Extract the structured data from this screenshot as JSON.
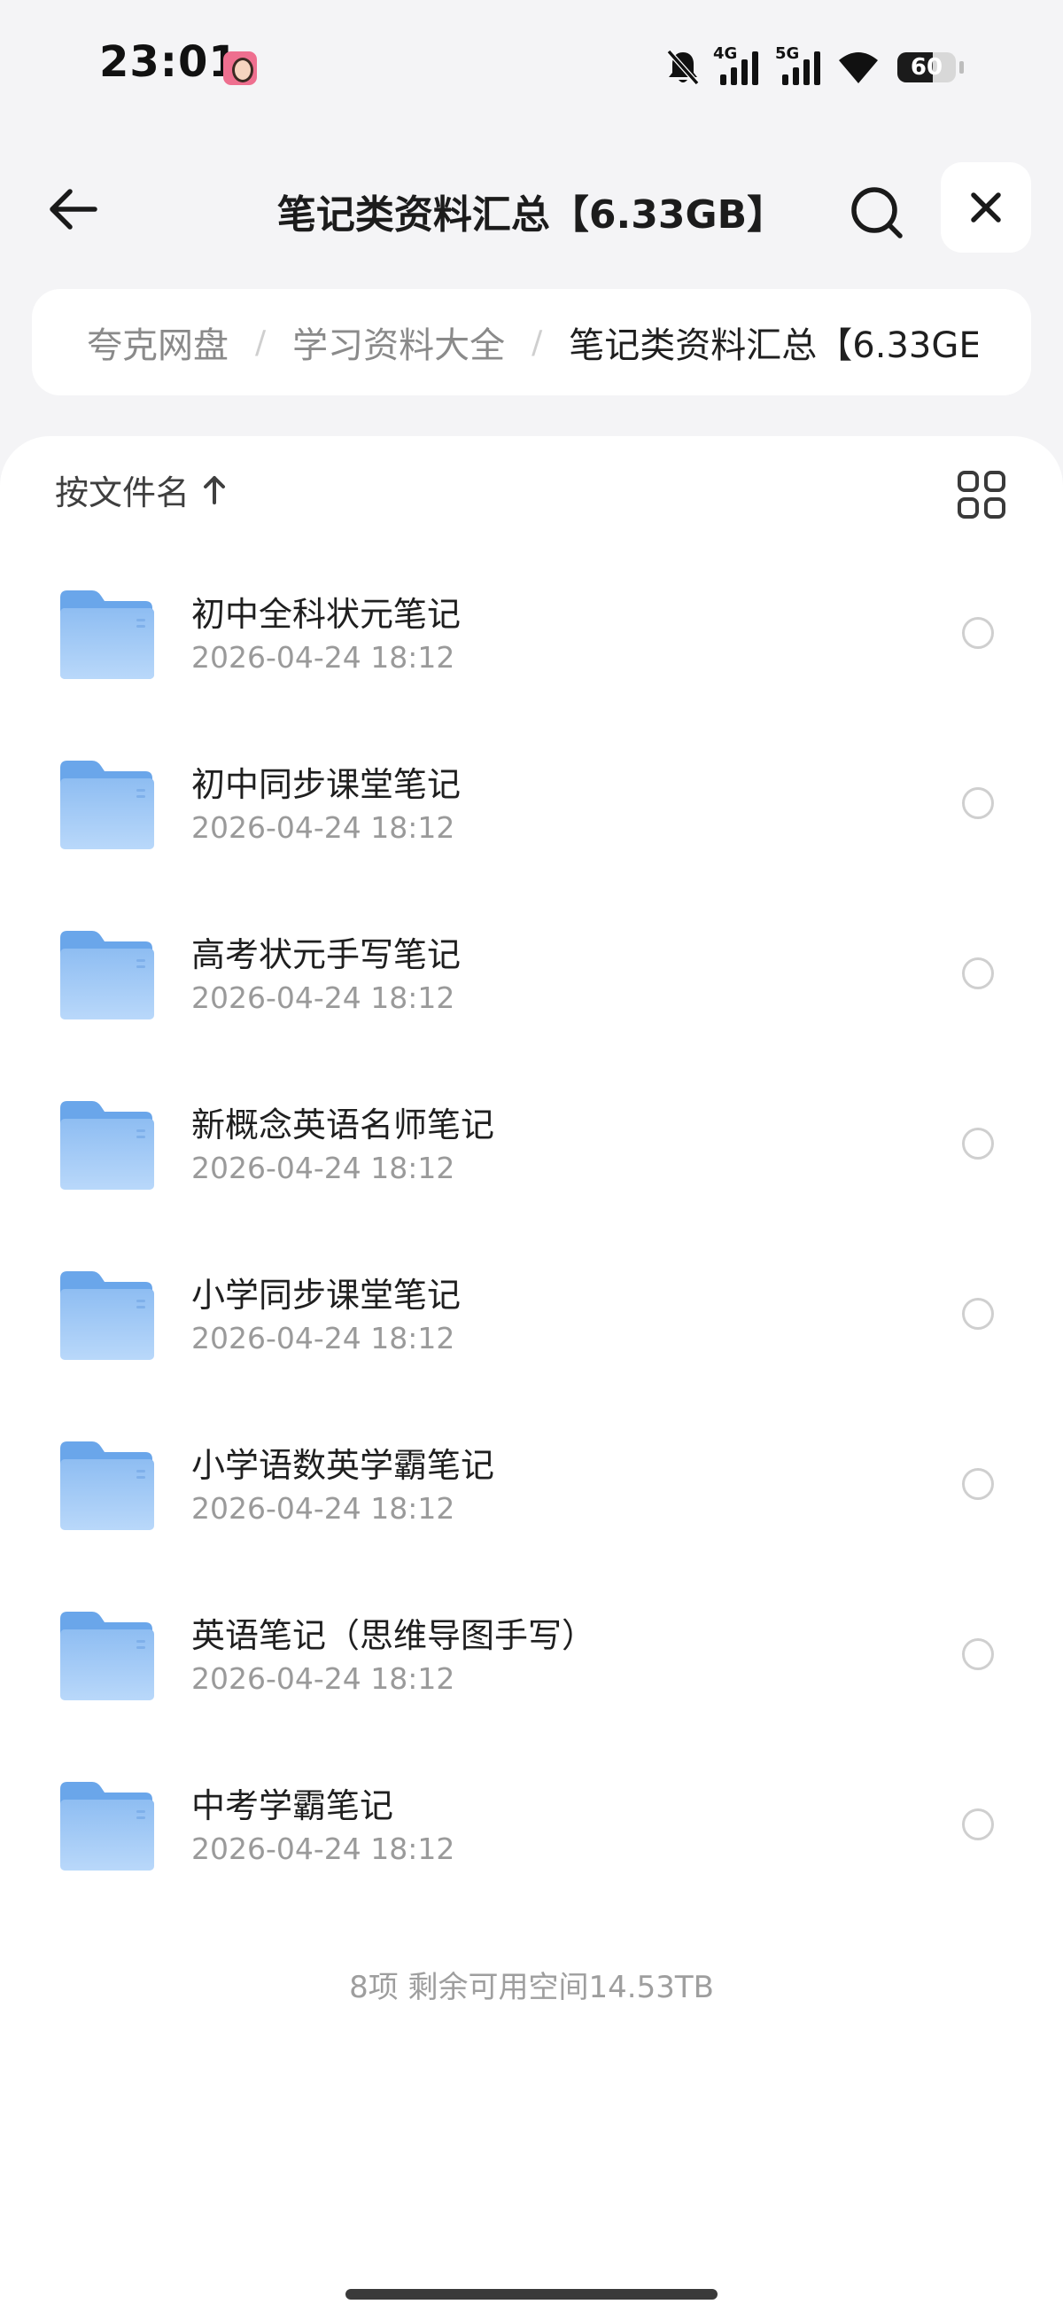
{
  "status_bar": {
    "time": "23:01",
    "network_1": "4G",
    "network_2": "5G",
    "battery_level": 60,
    "battery_text": "60",
    "icons": [
      "mute-bell-icon",
      "signal-icon",
      "signal-icon",
      "wifi-icon",
      "battery-icon"
    ]
  },
  "header": {
    "title": "笔记类资料汇总【6.33GB】",
    "icons": [
      "arrow-left-icon",
      "search-icon",
      "close-icon"
    ]
  },
  "breadcrumb": {
    "items": [
      "夸克网盘",
      "学习资料大全",
      "笔记类资料汇总【6.33GE"
    ],
    "separator": "/"
  },
  "toolbar": {
    "sort_label": "按文件名",
    "sort_direction_icon": "arrow-up-icon",
    "view_toggle_icon": "grid-view-icon"
  },
  "files": [
    {
      "name": "初中全科状元笔记",
      "date": "2026-04-24 18:12"
    },
    {
      "name": "初中同步课堂笔记",
      "date": "2026-04-24 18:12"
    },
    {
      "name": "高考状元手写笔记",
      "date": "2026-04-24 18:12"
    },
    {
      "name": "新概念英语名师笔记",
      "date": "2026-04-24 18:12"
    },
    {
      "name": "小学同步课堂笔记",
      "date": "2026-04-24 18:12"
    },
    {
      "name": "小学语数英学霸笔记",
      "date": "2026-04-24 18:12"
    },
    {
      "name": "英语笔记（思维导图手写）",
      "date": "2026-04-24 18:12"
    },
    {
      "name": "中考学霸笔记",
      "date": "2026-04-24 18:12"
    }
  ],
  "footer": {
    "summary": "8项 剩余可用空间14.53TB"
  },
  "colors": {
    "background": "#f4f4f6",
    "panel": "#ffffff",
    "folder_blue": "#8fbdf2",
    "folder_tab": "#6aa6ea",
    "text_primary": "#1f1f1f",
    "text_secondary": "#9a9a9a"
  }
}
